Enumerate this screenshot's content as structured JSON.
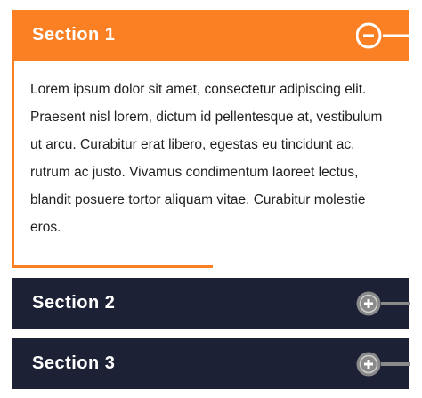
{
  "colors": {
    "accent": "#fb7f23",
    "dark": "#1c2135",
    "toggle_gray": "#8a8a8a"
  },
  "sections": [
    {
      "title": "Section 1",
      "state": "open",
      "toggle_icon": "minus-circle-icon",
      "content": "Lorem ipsum dolor sit amet, consectetur adipiscing elit. Praesent nisl lorem, dictum id pellentesque at, vestibulum ut arcu. Curabitur erat libero, egestas eu tincidunt ac, rutrum ac justo. Vivamus condimentum laoreet lectus, blandit posuere tortor aliquam vitae. Curabitur molestie eros."
    },
    {
      "title": "Section 2",
      "state": "closed",
      "toggle_icon": "plus-circle-icon"
    },
    {
      "title": "Section 3",
      "state": "closed",
      "toggle_icon": "plus-circle-icon"
    }
  ]
}
